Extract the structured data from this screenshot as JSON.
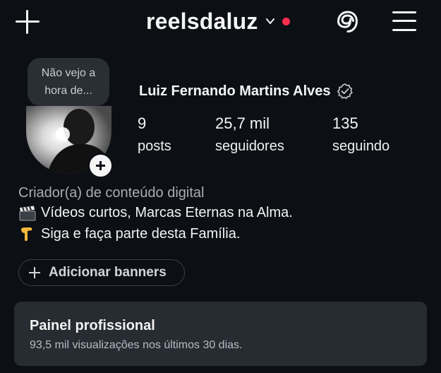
{
  "header": {
    "username": "reelsdaluz",
    "icons": [
      "plus-icon",
      "chevron-down-icon",
      "notification-dot",
      "threads-icon",
      "hamburger-menu-icon"
    ],
    "accent_dot_color": "#ff2e4e"
  },
  "note": {
    "line1": "Não vejo a",
    "line2": "hora de..."
  },
  "profile": {
    "full_name": "Luiz Fernando Martins Alves",
    "verified_icon": "verified-badge-icon",
    "stats": [
      {
        "value": "9",
        "label": "posts"
      },
      {
        "value": "25,7 mil",
        "label": "seguidores"
      },
      {
        "value": "135",
        "label": "seguindo"
      }
    ]
  },
  "bio": {
    "category": "Criador(a) de conteúdo digital",
    "line1_emoji": "clapper-board-icon",
    "line1": "Vídeos curtos, Marcas Eternas na Alma.",
    "line2_emoji": "pointing-down-hand-icon",
    "line2": "Siga e faça parte desta Família."
  },
  "actions": {
    "add_banners": "Adicionar banners"
  },
  "panel": {
    "title": "Painel profissional",
    "subtitle": "93,5 mil visualizações nos últimos 30 dias."
  }
}
